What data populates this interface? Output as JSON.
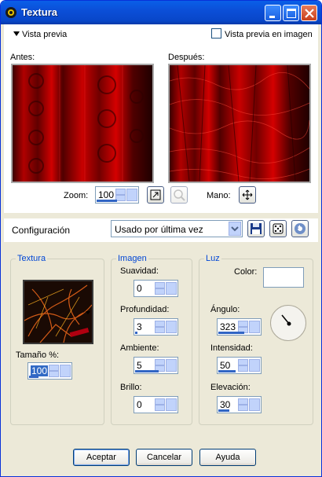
{
  "window": {
    "title": "Textura"
  },
  "preview": {
    "toggle_label": "Vista previa",
    "checkbox_label": "Vista previa en imagen",
    "before_label": "Antes:",
    "after_label": "Después:"
  },
  "zoom": {
    "label": "Zoom:",
    "value": "100",
    "hand_label": "Mano:"
  },
  "config": {
    "label": "Configuración",
    "preset": "Usado por última vez"
  },
  "textura": {
    "title": "Textura",
    "size_label": "Tamaño %:",
    "size_value": "100"
  },
  "imagen": {
    "title": "Imagen",
    "suavidad_label": "Suavidad:",
    "suavidad": "0",
    "profundidad_label": "Profundidad:",
    "profundidad": "3",
    "ambiente_label": "Ambiente:",
    "ambiente": "5",
    "brillo_label": "Brillo:",
    "brillo": "0"
  },
  "luz": {
    "title": "Luz",
    "color_label": "Color:",
    "angulo_label": "Ángulo:",
    "angulo": "323",
    "intensidad_label": "Intensidad:",
    "intensidad": "50",
    "elevacion_label": "Elevación:",
    "elevacion": "30"
  },
  "buttons": {
    "ok": "Aceptar",
    "cancel": "Cancelar",
    "help": "Ayuda"
  },
  "colors": {
    "title_bar": "#0b4fd8",
    "accent": "#0046d5",
    "preview_red": "#c00000"
  }
}
